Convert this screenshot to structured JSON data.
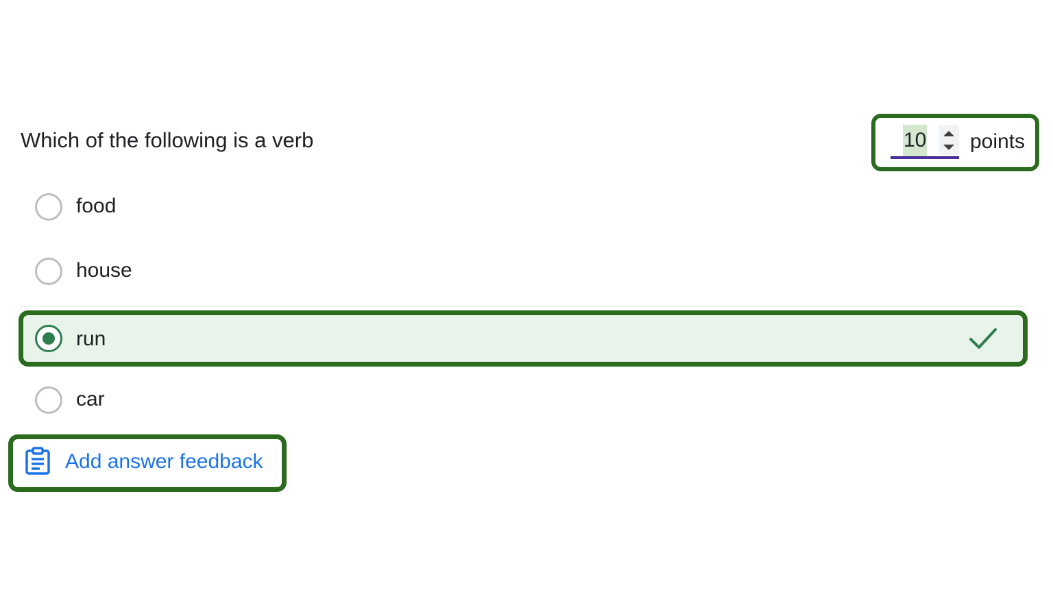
{
  "question": {
    "title": "Which of the following is a verb"
  },
  "points": {
    "value": "10",
    "label": "points"
  },
  "options": [
    {
      "label": "food",
      "selected": false
    },
    {
      "label": "house",
      "selected": false
    },
    {
      "label": "run",
      "selected": true,
      "correct": true
    },
    {
      "label": "car",
      "selected": false
    }
  ],
  "feedback": {
    "label": "Add answer feedback",
    "icon": "clipboard-icon"
  },
  "colors": {
    "highlight_border": "#2b6b1d",
    "correct_fill": "#e8f3ea",
    "correct_accent": "#2e7d4f",
    "link_blue": "#1a73e8",
    "input_underline": "#4b2e9a"
  }
}
